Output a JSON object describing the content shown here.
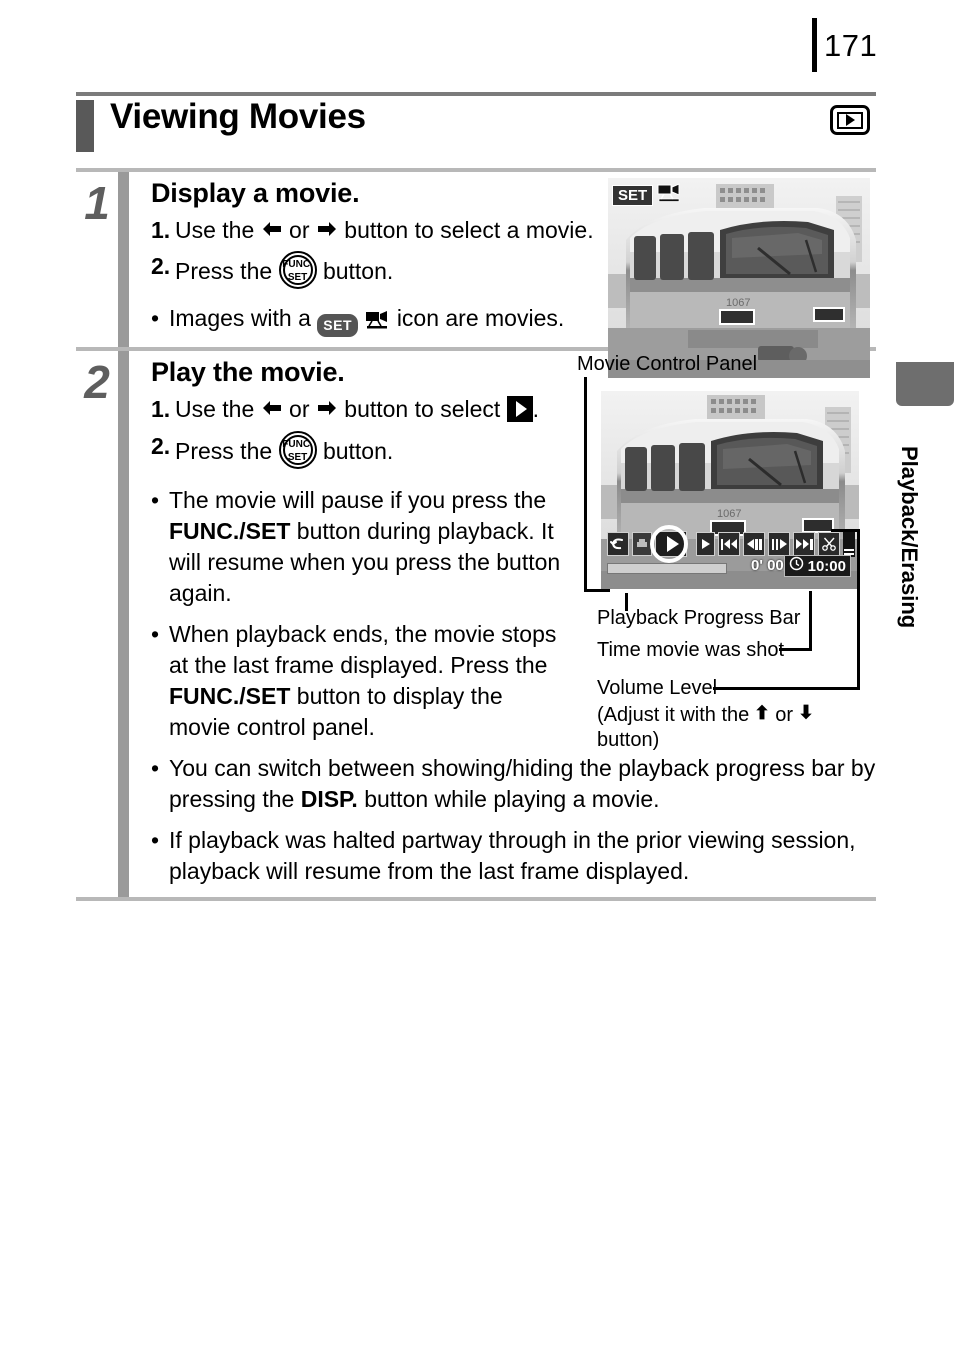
{
  "page": {
    "number": "171"
  },
  "side_tab": {
    "label": "Playback/Erasing"
  },
  "heading": {
    "title": "Viewing Movies",
    "mode_icon": "playback-mode-icon"
  },
  "steps": [
    {
      "number": "1",
      "title": "Display a movie.",
      "items": [
        {
          "n": "1.",
          "pre": "Use the",
          "mid": "or",
          "post": "button to select a movie.",
          "icons": [
            "left-arrow-icon",
            "right-arrow-icon"
          ]
        },
        {
          "n": "2.",
          "pre": "Press the",
          "post": "button.",
          "icons": [
            "func-set-button-icon"
          ]
        }
      ],
      "bullets": [
        {
          "pre": "Images with a",
          "post": "icon are movies.",
          "icons": [
            "set-badge-icon",
            "movie-camera-icon"
          ]
        }
      ]
    },
    {
      "number": "2",
      "title": "Play the movie.",
      "items": [
        {
          "n": "1.",
          "pre": "Use the",
          "mid": "or",
          "post": "button to select",
          "tail": ".",
          "icons": [
            "left-arrow-icon",
            "right-arrow-icon",
            "play-icon"
          ]
        },
        {
          "n": "2.",
          "pre": "Press the",
          "post": "button.",
          "icons": [
            "func-set-button-icon"
          ]
        }
      ],
      "bullets": [
        {
          "text_a": "The movie will pause if you press the ",
          "bold_a": "FUNC./SET",
          "text_b": " button during playback. It will resume when you press the button again."
        },
        {
          "text_a": "When playback ends, the movie stops at the last frame displayed. Press the ",
          "bold_a": "FUNC./SET",
          "text_b": " button to display the movie control panel."
        },
        {
          "text_a": "You can switch between showing/hiding the playback progress bar by pressing the ",
          "bold_a": "DISP.",
          "text_b": " button while playing a movie."
        },
        {
          "text_a": "If playback was halted partway through in the prior viewing session, playback will resume from the last frame displayed."
        }
      ]
    }
  ],
  "figure_step1": {
    "overlay_badge": "SET",
    "overlay_icon": "movie-camera-icon",
    "image_alt": "monorail-train-photo"
  },
  "figure_step2": {
    "caption": "Movie Control Panel",
    "callouts": [
      {
        "label": "Playback Progress Bar"
      },
      {
        "label": "Time movie was shot"
      },
      {
        "label": "Volume Level"
      },
      {
        "label_a": "(Adjust it with the",
        "label_or": "or",
        "label_b": "button)",
        "icons": [
          "up-arrow-icon",
          "down-arrow-icon"
        ]
      }
    ],
    "panel_buttons": [
      "exit-icon",
      "print-icon",
      "play-icon",
      "slow-motion-icon",
      "first-frame-icon",
      "previous-frame-icon",
      "next-frame-icon",
      "last-frame-icon",
      "edit-scissors-icon",
      "volume-level-icon"
    ],
    "elapsed_time": "0' 00\"",
    "clock_icon": "clock-icon",
    "shot_time": "10:00"
  },
  "colors": {
    "heading_bar": "#595959",
    "gutter": "#9a9a9a",
    "rule": "#b8b8b8",
    "tab": "#6e6e6e"
  }
}
